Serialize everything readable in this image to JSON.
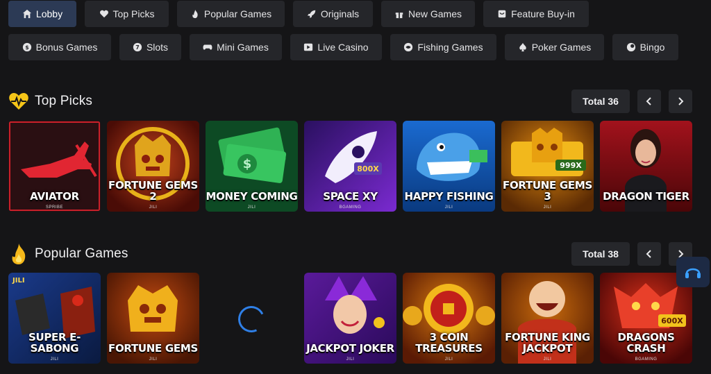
{
  "categories_row1": [
    {
      "label": "Lobby",
      "icon": "home-icon",
      "active": true
    },
    {
      "label": "Top Picks",
      "icon": "heart-pulse-icon"
    },
    {
      "label": "Popular Games",
      "icon": "flame-icon"
    },
    {
      "label": "Originals",
      "icon": "rocket-icon"
    },
    {
      "label": "New Games",
      "icon": "gift-icon"
    },
    {
      "label": "Feature Buy-in",
      "icon": "cart-icon"
    }
  ],
  "categories_row2": [
    {
      "label": "Bonus Games",
      "icon": "coin-icon"
    },
    {
      "label": "Slots",
      "icon": "slots-icon"
    },
    {
      "label": "Mini Games",
      "icon": "gamepad-icon"
    },
    {
      "label": "Live Casino",
      "icon": "video-icon"
    },
    {
      "label": "Fishing Games",
      "icon": "fish-icon"
    },
    {
      "label": "Poker Games",
      "icon": "spade-icon"
    },
    {
      "label": "Bingo",
      "icon": "bingo-icon"
    }
  ],
  "top_picks": {
    "title": "Top Picks",
    "total": "Total 36",
    "games": [
      {
        "name": "AVIATOR",
        "provider": "SPRIBE",
        "bg": "#3a1014",
        "accent": "#d8232e"
      },
      {
        "name": "FORTUNE GEMS 2",
        "provider": "JILI",
        "bg": "#7a1d0e",
        "accent": "#f0b400"
      },
      {
        "name": "MONEY COMING",
        "provider": "JILI",
        "bg": "#0f5a2c",
        "accent": "#35c460"
      },
      {
        "name": "SPACE XY",
        "provider": "BGAMING",
        "bg": "#3a1a8a",
        "accent": "#9b5cff"
      },
      {
        "name": "HAPPY FISHING",
        "provider": "JILI",
        "bg": "#0f4f9e",
        "accent": "#3aa0ff"
      },
      {
        "name": "FORTUNE GEMS 3",
        "provider": "JILI",
        "bg": "#8a4a06",
        "accent": "#f3bd1c"
      },
      {
        "name": "DRAGON TIGER",
        "provider": "",
        "bg": "#6b0c12",
        "accent": "#c7202a"
      }
    ]
  },
  "popular_games": {
    "title": "Popular Games",
    "total": "Total 38",
    "games": [
      {
        "name": "SUPER E-SABONG",
        "provider": "JILI",
        "bg": "#14306b",
        "accent": "#2a6ad8",
        "badge": "JILI"
      },
      {
        "name": "FORTUNE GEMS",
        "provider": "JILI",
        "bg": "#7a2a08",
        "accent": "#f0a400"
      },
      {
        "name": "",
        "provider": "",
        "loading": true
      },
      {
        "name": "JACKPOT JOKER",
        "provider": "JILI",
        "bg": "#4a1a7a",
        "accent": "#9a3ae0"
      },
      {
        "name": "3 COIN TREASURES",
        "provider": "JILI",
        "bg": "#8a3a06",
        "accent": "#e9a21a"
      },
      {
        "name": "FORTUNE KING JACKPOT",
        "provider": "JILI",
        "bg": "#8a3a06",
        "accent": "#f2c31c"
      },
      {
        "name": "DRAGONS CRASH",
        "provider": "BGAMING",
        "bg": "#7a0c0c",
        "accent": "#e2342a",
        "badge": "600X"
      }
    ]
  },
  "badges": {
    "space_xy": "800X",
    "fortune_gems_3": "999X",
    "dragons_crash": "600X"
  }
}
